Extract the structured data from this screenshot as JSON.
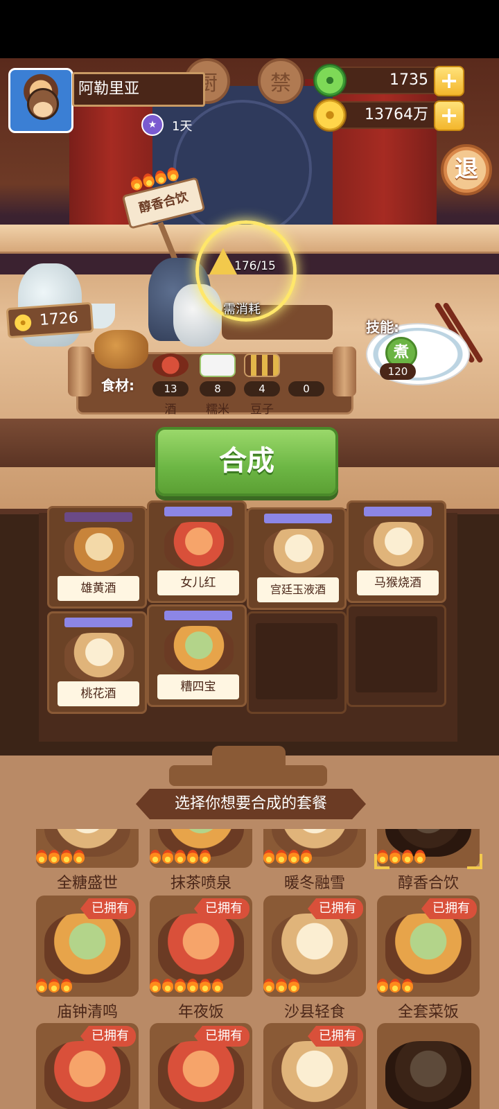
{
  "player": {
    "name": "阿勒里亚",
    "days": "1天"
  },
  "currency": {
    "jade": "1735",
    "coins": "13764万"
  },
  "exit_button": "退",
  "scene": {
    "sign_chars": [
      "厨",
      "禁"
    ],
    "recipe_name": "醇香合饮",
    "cost_value": "176/15",
    "cost_label": "需消耗",
    "price": "1726"
  },
  "skill": {
    "label": "技能:",
    "icon_char": "煮",
    "count": "120"
  },
  "ingredients": {
    "label": "食材:",
    "items": [
      {
        "count": "13",
        "name": "酒"
      },
      {
        "count": "8",
        "name": "糯米"
      },
      {
        "count": "4",
        "name": "豆子"
      },
      {
        "count": "0",
        "name": ""
      }
    ]
  },
  "synth_button": "合成",
  "cabinet": {
    "slots": [
      {
        "label": "雄黄酒",
        "filled": true
      },
      {
        "label": "女儿红",
        "filled": true
      },
      {
        "label": "宫廷玉液酒",
        "filled": true
      },
      {
        "label": "马猴烧酒",
        "filled": true
      },
      {
        "label": "桃花酒",
        "filled": true
      },
      {
        "label": "糟四宝",
        "filled": true
      },
      {
        "label": "",
        "filled": false
      },
      {
        "label": "",
        "filled": false
      }
    ]
  },
  "menu": {
    "banner": "选择你想要合成的套餐",
    "owned_label": "已拥有",
    "row1": [
      {
        "name": "全糖盛世",
        "fires": 4
      },
      {
        "name": "抹茶喷泉",
        "fires": 5
      },
      {
        "name": "暖冬融雪",
        "fires": 4
      },
      {
        "name": "醇香合饮",
        "fires": 4,
        "selected": true
      }
    ],
    "row2": [
      {
        "name": "庙钟清鸣",
        "fires": 3,
        "owned": true
      },
      {
        "name": "年夜饭",
        "fires": 6,
        "owned": true
      },
      {
        "name": "沙县轻食",
        "fires": 3,
        "owned": true
      },
      {
        "name": "全套菜饭",
        "fires": 3,
        "owned": true
      }
    ],
    "row3": [
      {
        "owned": true
      },
      {
        "owned": true
      },
      {
        "owned": true
      },
      {
        "owned": false
      }
    ]
  },
  "colors": {
    "accent_green": "#6cb644",
    "owned_badge": "#d9503a",
    "wood_dark": "#4a2618",
    "slot_bar": "#8c86e6"
  }
}
